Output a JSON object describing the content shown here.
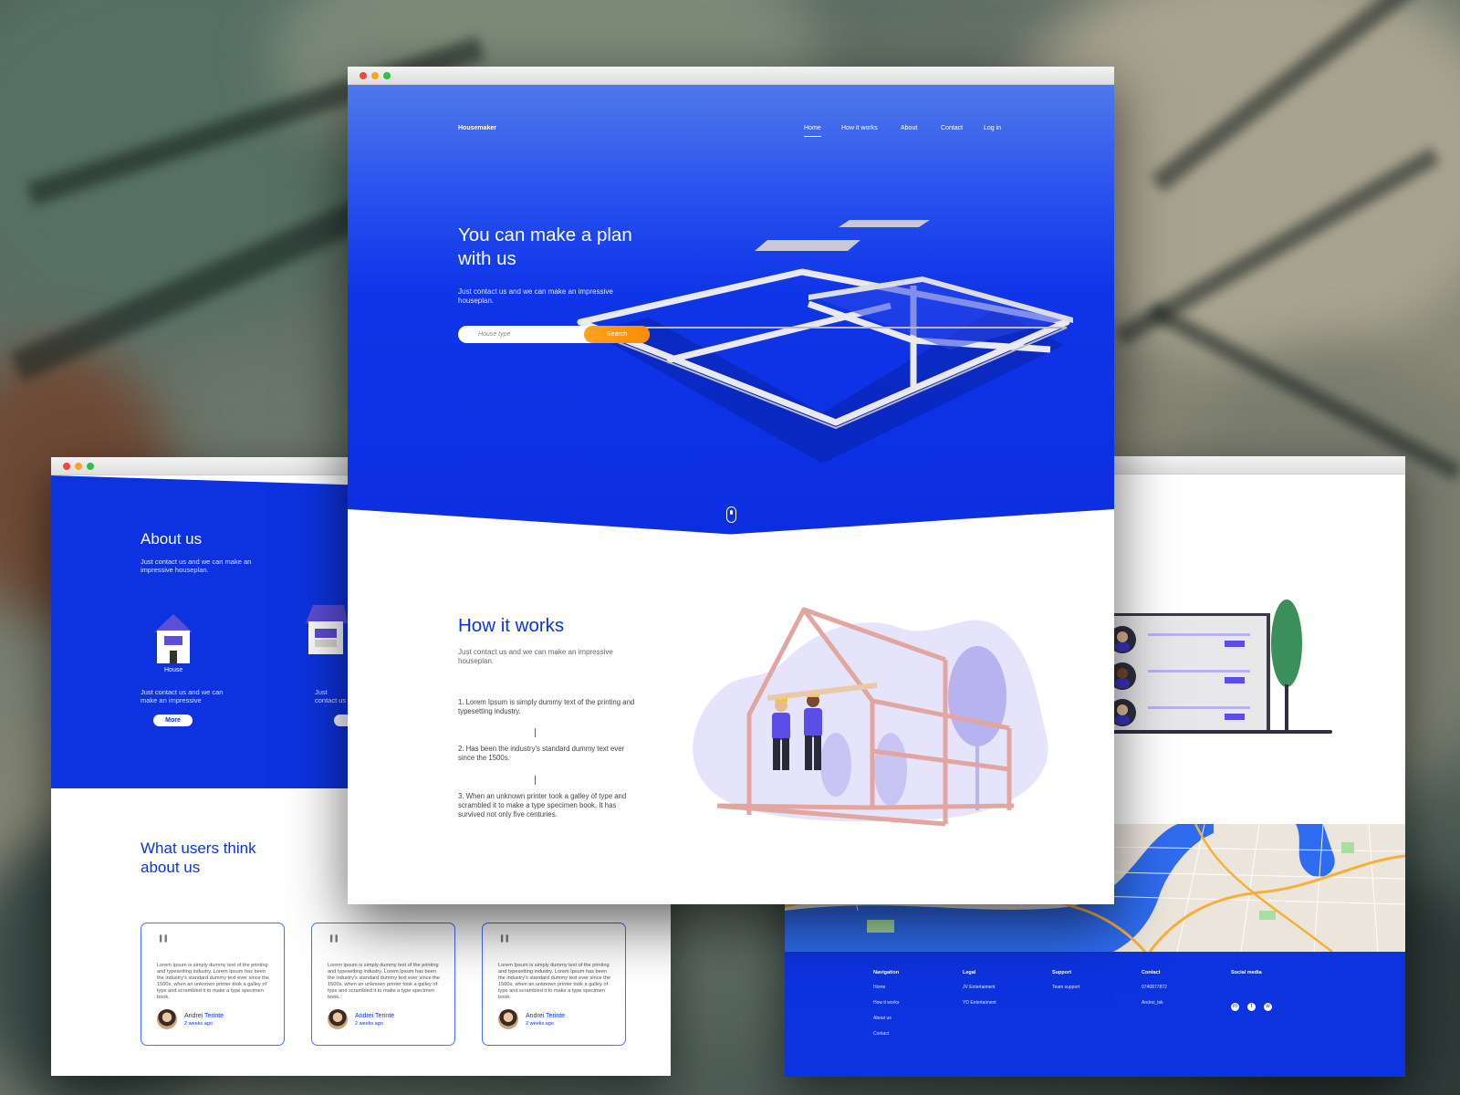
{
  "center": {
    "brand": "Housemaker",
    "nav": [
      "Home",
      "How it works",
      "About",
      "Contact",
      "Log in"
    ],
    "hero": {
      "title": "You can make a plan with us",
      "subtitle": "Just contact us and we can make an impressive houseplan.",
      "search_placeholder": "House type",
      "search_button": "Search"
    },
    "how": {
      "title": "How it works",
      "subtitle": "Just contact us and we can make an impressive houseplan.",
      "steps": [
        "1. Lorem Ipsum is simply dummy text of the printing and typesetting industry.",
        "2. Has been the industry's standard dummy text ever since the 1500s.",
        "3. When an unknown printer took a galley of type and scrambled it to make a type specimen book. It has survived not only five centuries."
      ]
    }
  },
  "left": {
    "about_title": "About us",
    "about_sub": "Just contact us and we can make an impressive houseplan.",
    "service_label": "House",
    "service_text": "Just contact us and we can make an impressive",
    "service_text_2": "Just contact us and we can make an impressive houseplan.",
    "more_button": "More",
    "users_title": "What users think about us",
    "testimonials": [
      {
        "text": "Lorem Ipsum is simply dummy text of the printing and typesetting industry. Lorem Ipsum has been the industry's standard dummy text ever since the 1500s, when an unknown printer took a galley of type and scrambled it to make a type specimen book.",
        "name": "Andrei Terinte",
        "date": "2 weeks ago"
      },
      {
        "text": "Lorem Ipsum is simply dummy text of the printing and typesetting industry. Lorem Ipsum has been the industry's standard dummy text ever since the 1500s, when an unknown printer took a galley of type and scrambled it to make a type specimen book.",
        "name": "Andrei Terinte",
        "date": "2 weeks ago"
      },
      {
        "text": "Lorem Ipsum is simply dummy text of the printing and typesetting industry. Lorem Ipsum has been the industry's standard dummy text ever since the 1500s, when an unknown printer took a galley of type and scrambled it to make a type specimen book.",
        "name": "Andrei Terinte",
        "date": "2 weeks ago"
      }
    ]
  },
  "right": {
    "footer": {
      "navigation": {
        "title": "Navigation",
        "items": [
          "Home",
          "How it works",
          "About us",
          "Contact"
        ]
      },
      "legal": {
        "title": "Legal",
        "items": [
          "JV Entertaiment",
          "YD Entertaiment"
        ]
      },
      "support": {
        "title": "Support",
        "items": [
          "Team support"
        ]
      },
      "contact": {
        "title": "Contact",
        "items": [
          "0740877872",
          "Andrei_tsk"
        ]
      },
      "social": {
        "title": "Social media",
        "icons": [
          "messenger-icon",
          "twitter-icon",
          "whatsapp-icon"
        ]
      }
    }
  },
  "colors": {
    "primary": "#0d33e0",
    "accent": "#ff9500",
    "hero_top": "#4f78ea"
  }
}
